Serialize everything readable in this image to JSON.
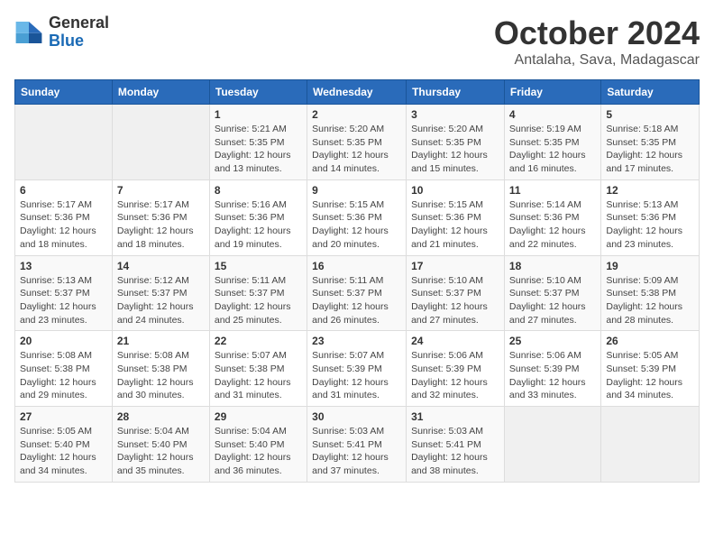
{
  "header": {
    "logo_general": "General",
    "logo_blue": "Blue",
    "month_title": "October 2024",
    "location": "Antalaha, Sava, Madagascar"
  },
  "weekdays": [
    "Sunday",
    "Monday",
    "Tuesday",
    "Wednesday",
    "Thursday",
    "Friday",
    "Saturday"
  ],
  "weeks": [
    [
      {
        "day": "",
        "content": ""
      },
      {
        "day": "",
        "content": ""
      },
      {
        "day": "1",
        "content": "Sunrise: 5:21 AM\nSunset: 5:35 PM\nDaylight: 12 hours\nand 13 minutes."
      },
      {
        "day": "2",
        "content": "Sunrise: 5:20 AM\nSunset: 5:35 PM\nDaylight: 12 hours\nand 14 minutes."
      },
      {
        "day": "3",
        "content": "Sunrise: 5:20 AM\nSunset: 5:35 PM\nDaylight: 12 hours\nand 15 minutes."
      },
      {
        "day": "4",
        "content": "Sunrise: 5:19 AM\nSunset: 5:35 PM\nDaylight: 12 hours\nand 16 minutes."
      },
      {
        "day": "5",
        "content": "Sunrise: 5:18 AM\nSunset: 5:35 PM\nDaylight: 12 hours\nand 17 minutes."
      }
    ],
    [
      {
        "day": "6",
        "content": "Sunrise: 5:17 AM\nSunset: 5:36 PM\nDaylight: 12 hours\nand 18 minutes."
      },
      {
        "day": "7",
        "content": "Sunrise: 5:17 AM\nSunset: 5:36 PM\nDaylight: 12 hours\nand 18 minutes."
      },
      {
        "day": "8",
        "content": "Sunrise: 5:16 AM\nSunset: 5:36 PM\nDaylight: 12 hours\nand 19 minutes."
      },
      {
        "day": "9",
        "content": "Sunrise: 5:15 AM\nSunset: 5:36 PM\nDaylight: 12 hours\nand 20 minutes."
      },
      {
        "day": "10",
        "content": "Sunrise: 5:15 AM\nSunset: 5:36 PM\nDaylight: 12 hours\nand 21 minutes."
      },
      {
        "day": "11",
        "content": "Sunrise: 5:14 AM\nSunset: 5:36 PM\nDaylight: 12 hours\nand 22 minutes."
      },
      {
        "day": "12",
        "content": "Sunrise: 5:13 AM\nSunset: 5:36 PM\nDaylight: 12 hours\nand 23 minutes."
      }
    ],
    [
      {
        "day": "13",
        "content": "Sunrise: 5:13 AM\nSunset: 5:37 PM\nDaylight: 12 hours\nand 23 minutes."
      },
      {
        "day": "14",
        "content": "Sunrise: 5:12 AM\nSunset: 5:37 PM\nDaylight: 12 hours\nand 24 minutes."
      },
      {
        "day": "15",
        "content": "Sunrise: 5:11 AM\nSunset: 5:37 PM\nDaylight: 12 hours\nand 25 minutes."
      },
      {
        "day": "16",
        "content": "Sunrise: 5:11 AM\nSunset: 5:37 PM\nDaylight: 12 hours\nand 26 minutes."
      },
      {
        "day": "17",
        "content": "Sunrise: 5:10 AM\nSunset: 5:37 PM\nDaylight: 12 hours\nand 27 minutes."
      },
      {
        "day": "18",
        "content": "Sunrise: 5:10 AM\nSunset: 5:37 PM\nDaylight: 12 hours\nand 27 minutes."
      },
      {
        "day": "19",
        "content": "Sunrise: 5:09 AM\nSunset: 5:38 PM\nDaylight: 12 hours\nand 28 minutes."
      }
    ],
    [
      {
        "day": "20",
        "content": "Sunrise: 5:08 AM\nSunset: 5:38 PM\nDaylight: 12 hours\nand 29 minutes."
      },
      {
        "day": "21",
        "content": "Sunrise: 5:08 AM\nSunset: 5:38 PM\nDaylight: 12 hours\nand 30 minutes."
      },
      {
        "day": "22",
        "content": "Sunrise: 5:07 AM\nSunset: 5:38 PM\nDaylight: 12 hours\nand 31 minutes."
      },
      {
        "day": "23",
        "content": "Sunrise: 5:07 AM\nSunset: 5:39 PM\nDaylight: 12 hours\nand 31 minutes."
      },
      {
        "day": "24",
        "content": "Sunrise: 5:06 AM\nSunset: 5:39 PM\nDaylight: 12 hours\nand 32 minutes."
      },
      {
        "day": "25",
        "content": "Sunrise: 5:06 AM\nSunset: 5:39 PM\nDaylight: 12 hours\nand 33 minutes."
      },
      {
        "day": "26",
        "content": "Sunrise: 5:05 AM\nSunset: 5:39 PM\nDaylight: 12 hours\nand 34 minutes."
      }
    ],
    [
      {
        "day": "27",
        "content": "Sunrise: 5:05 AM\nSunset: 5:40 PM\nDaylight: 12 hours\nand 34 minutes."
      },
      {
        "day": "28",
        "content": "Sunrise: 5:04 AM\nSunset: 5:40 PM\nDaylight: 12 hours\nand 35 minutes."
      },
      {
        "day": "29",
        "content": "Sunrise: 5:04 AM\nSunset: 5:40 PM\nDaylight: 12 hours\nand 36 minutes."
      },
      {
        "day": "30",
        "content": "Sunrise: 5:03 AM\nSunset: 5:41 PM\nDaylight: 12 hours\nand 37 minutes."
      },
      {
        "day": "31",
        "content": "Sunrise: 5:03 AM\nSunset: 5:41 PM\nDaylight: 12 hours\nand 38 minutes."
      },
      {
        "day": "",
        "content": ""
      },
      {
        "day": "",
        "content": ""
      }
    ]
  ]
}
